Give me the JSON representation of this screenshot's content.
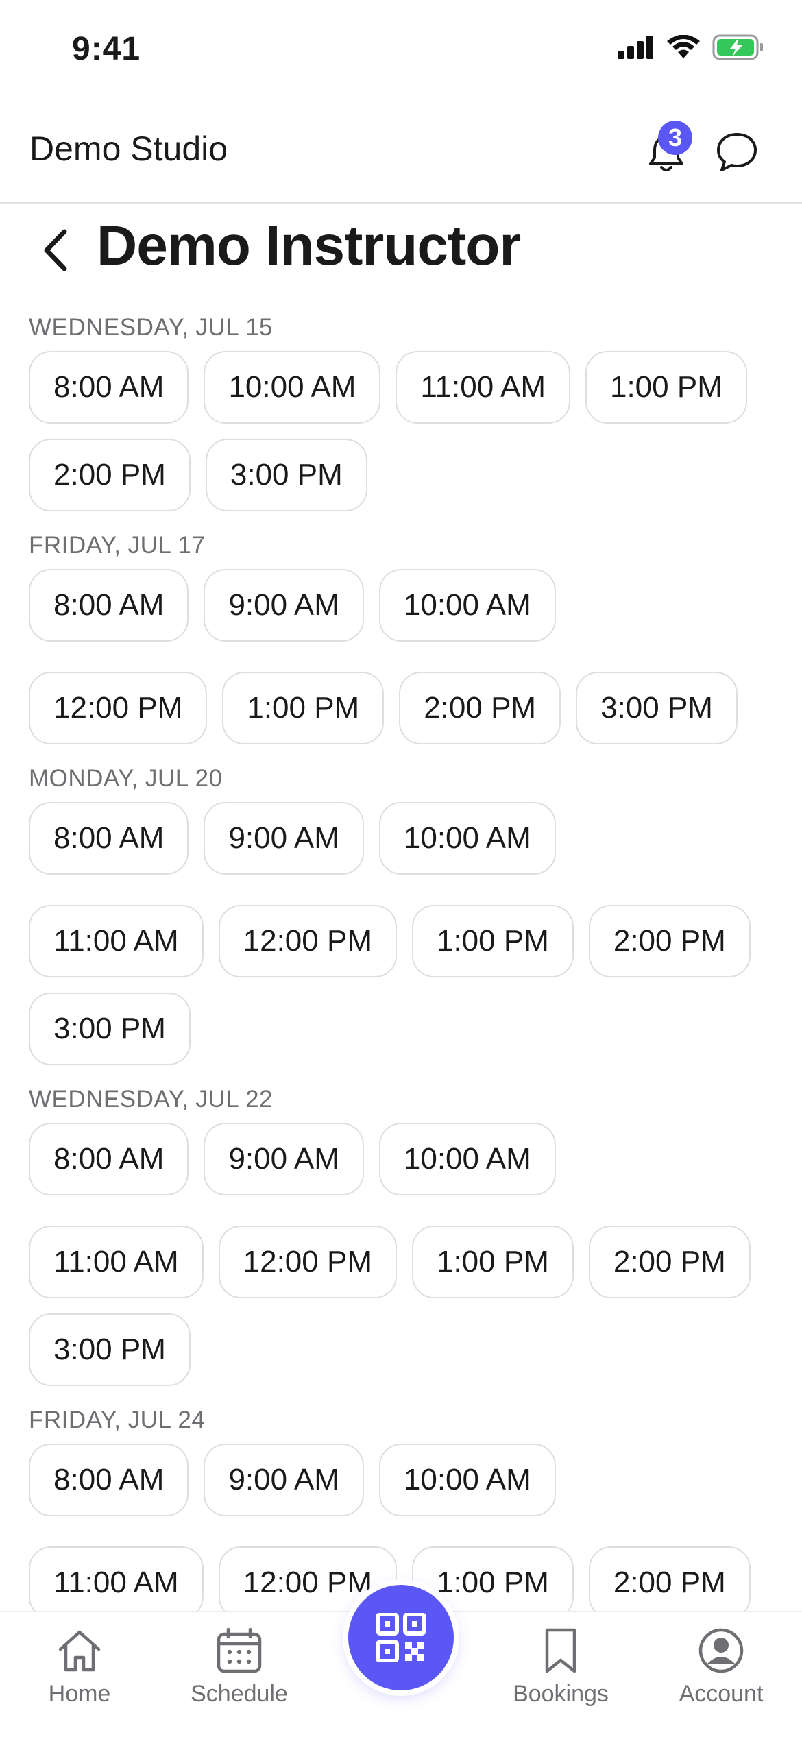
{
  "status_bar": {
    "time": "9:41"
  },
  "header": {
    "studio_name": "Demo Studio",
    "notification_count": "3"
  },
  "page": {
    "title": "Demo Instructor"
  },
  "days": [
    {
      "label": "WEDNESDAY, JUL 15",
      "slots": [
        "8:00 AM",
        "10:00 AM",
        "11:00 AM",
        "1:00 PM",
        "2:00 PM",
        "3:00 PM"
      ]
    },
    {
      "label": "FRIDAY, JUL 17",
      "slots": [
        "8:00 AM",
        "9:00 AM",
        "10:00 AM",
        "12:00 PM",
        "1:00 PM",
        "2:00 PM",
        "3:00 PM"
      ]
    },
    {
      "label": "MONDAY, JUL 20",
      "slots": [
        "8:00 AM",
        "9:00 AM",
        "10:00 AM",
        "11:00 AM",
        "12:00 PM",
        "1:00 PM",
        "2:00 PM",
        "3:00 PM"
      ]
    },
    {
      "label": "WEDNESDAY, JUL 22",
      "slots": [
        "8:00 AM",
        "9:00 AM",
        "10:00 AM",
        "11:00 AM",
        "12:00 PM",
        "1:00 PM",
        "2:00 PM",
        "3:00 PM"
      ]
    },
    {
      "label": "FRIDAY, JUL 24",
      "slots": [
        "8:00 AM",
        "9:00 AM",
        "10:00 AM",
        "11:00 AM",
        "12:00 PM",
        "1:00 PM",
        "2:00 PM"
      ]
    }
  ],
  "bottom_nav": {
    "home": "Home",
    "schedule": "Schedule",
    "bookings": "Bookings",
    "account": "Account"
  },
  "colors": {
    "accent": "#5b57f5",
    "battery": "#34c759"
  }
}
